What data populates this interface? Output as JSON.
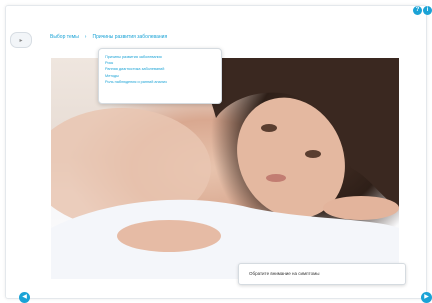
{
  "breadcrumb": {
    "items": [
      "Выбор темы",
      "Причины развития заболевания"
    ],
    "separator": "›"
  },
  "menu_toggle": {
    "icon": "chevron-right-icon"
  },
  "dropdown": {
    "items": [
      "Причины развития заболевания",
      "Риск",
      "Ранняя диагностика заболеваний",
      "Методы",
      "Роль наблюдения и ранний анализ"
    ]
  },
  "caption": {
    "text": "Обратите внимание на симптомы"
  },
  "nav": {
    "prev_icon": "◀",
    "next_icon": "▶"
  },
  "top_icons": [
    "?",
    "i"
  ],
  "colors": {
    "accent": "#1ba3d6",
    "panel_border": "#d5dbe0"
  }
}
